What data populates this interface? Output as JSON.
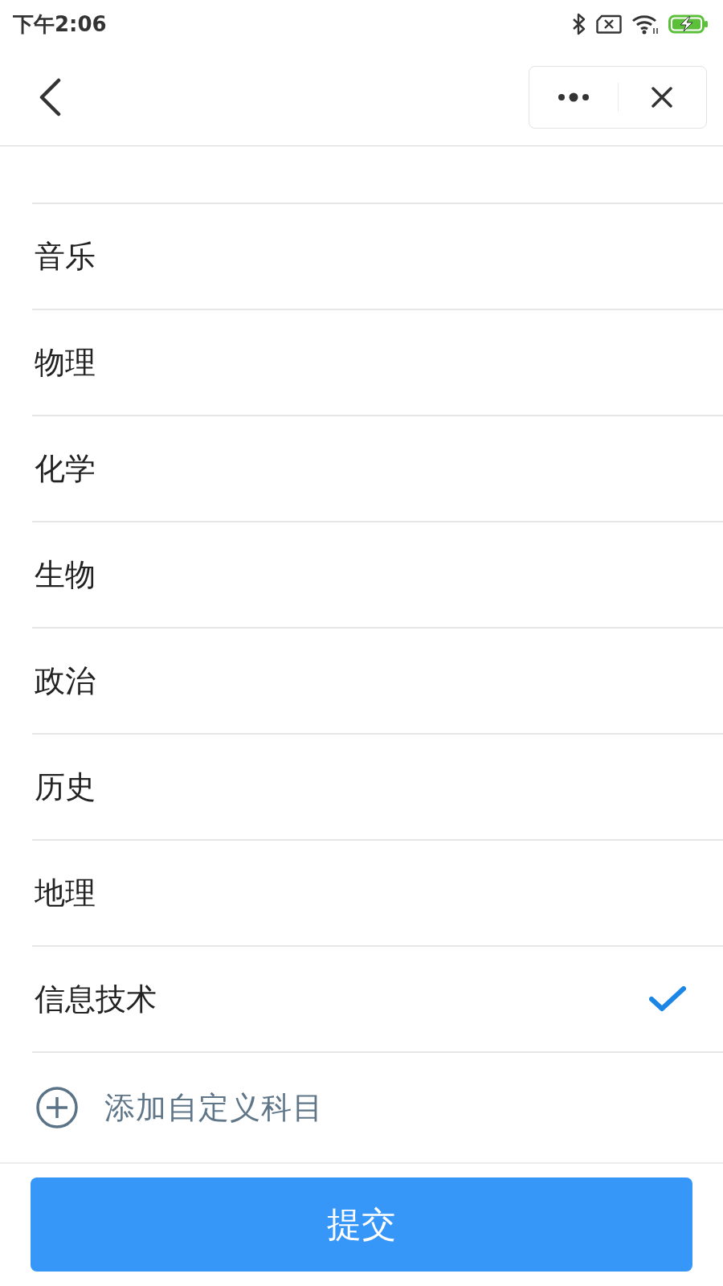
{
  "status_bar": {
    "time": "下午2:06"
  },
  "subjects": [
    {
      "name": "音乐",
      "selected": false
    },
    {
      "name": "物理",
      "selected": false
    },
    {
      "name": "化学",
      "selected": false
    },
    {
      "name": "生物",
      "selected": false
    },
    {
      "name": "政治",
      "selected": false
    },
    {
      "name": "历史",
      "selected": false
    },
    {
      "name": "地理",
      "selected": false
    },
    {
      "name": "信息技术",
      "selected": true
    }
  ],
  "add_custom": {
    "label": "添加自定义科目"
  },
  "submit_button": {
    "label": "提交"
  }
}
